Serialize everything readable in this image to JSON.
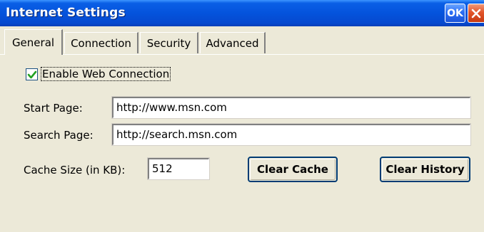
{
  "window": {
    "title": "Internet Settings",
    "ok_label": "OK",
    "close_icon": "close-icon"
  },
  "tabs": [
    {
      "label": "General",
      "active": true
    },
    {
      "label": "Connection",
      "active": false
    },
    {
      "label": "Security",
      "active": false
    },
    {
      "label": "Advanced",
      "active": false
    }
  ],
  "general": {
    "enable_web_connection": {
      "label": "Enable Web Connection",
      "checked": true
    },
    "start_page": {
      "label": "Start Page:",
      "value": "http://www.msn.com"
    },
    "search_page": {
      "label": "Search Page:",
      "value": "http://search.msn.com"
    },
    "cache_size": {
      "label": "Cache Size (in KB):",
      "value": "512"
    },
    "clear_cache_label": "Clear Cache",
    "clear_history_label": "Clear History"
  },
  "colors": {
    "titlebar": "#0453dc",
    "panel": "#ece9d8",
    "checkmark": "#21a121",
    "close_button": "#e2552a"
  }
}
